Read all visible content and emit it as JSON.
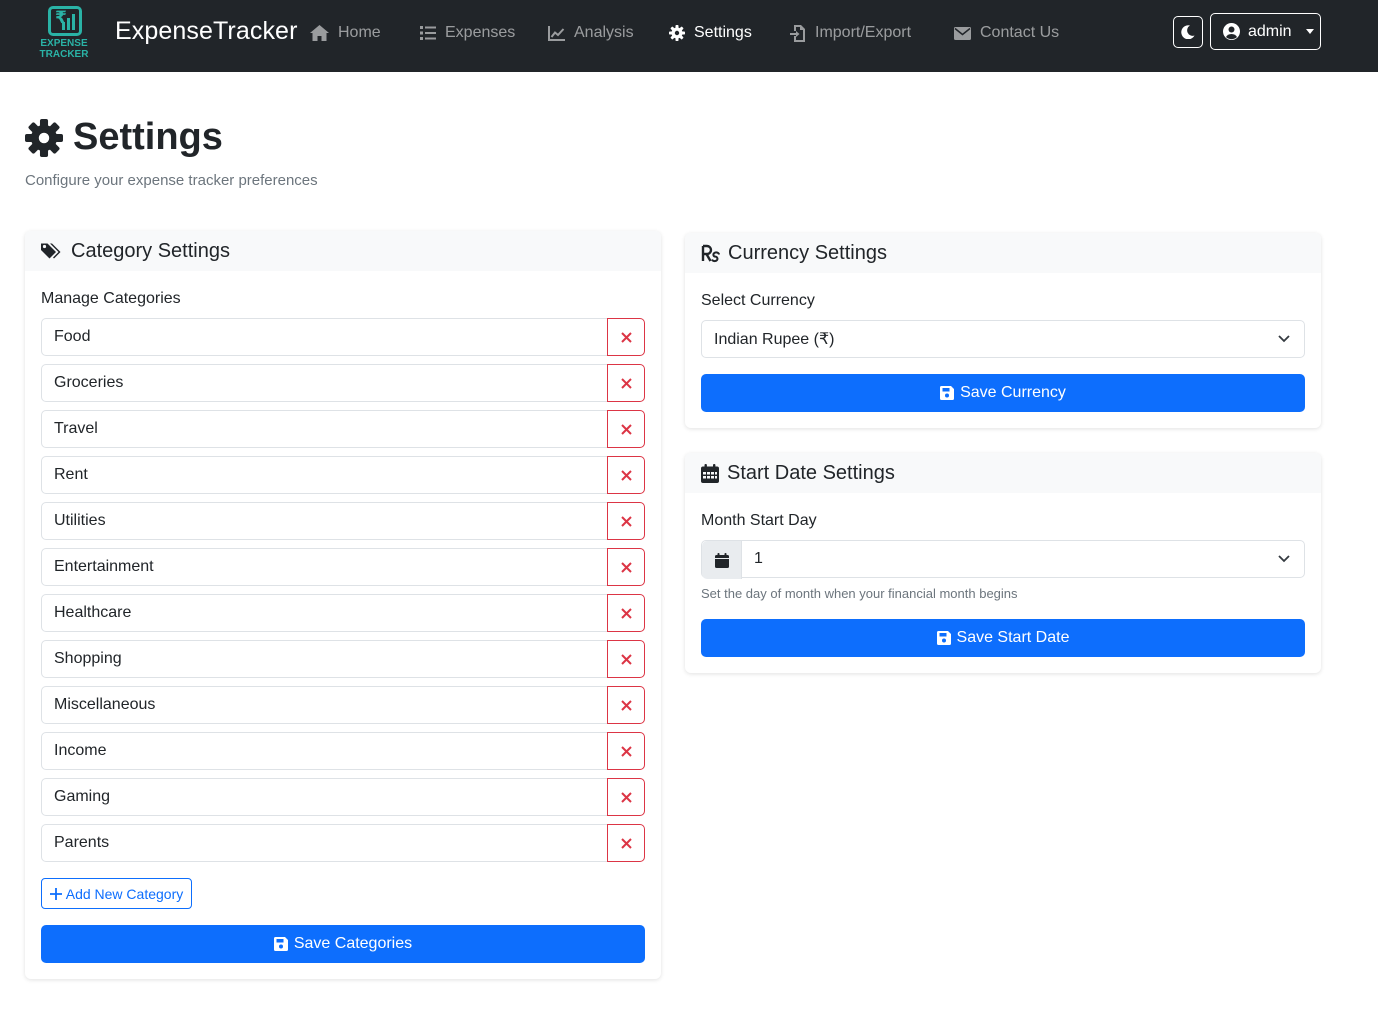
{
  "brand": {
    "logo_text": "EXPENSE TRACKER",
    "name": "ExpenseTracker",
    "accent": "#2ab3a6"
  },
  "nav": {
    "items": [
      {
        "label": "Home",
        "icon": "home-icon"
      },
      {
        "label": "Expenses",
        "icon": "list-icon"
      },
      {
        "label": "Analysis",
        "icon": "chart-line-icon"
      },
      {
        "label": "Settings",
        "icon": "gear-icon",
        "active": true
      },
      {
        "label": "Import/Export",
        "icon": "file-import-icon"
      },
      {
        "label": "Contact Us",
        "icon": "envelope-icon"
      }
    ],
    "user": "admin",
    "theme_icon": "moon-icon"
  },
  "page": {
    "title": "Settings",
    "subtitle": "Configure your expense tracker preferences"
  },
  "category_settings": {
    "title": "Category Settings",
    "label": "Manage Categories",
    "categories": [
      "Food",
      "Groceries",
      "Travel",
      "Rent",
      "Utilities",
      "Entertainment",
      "Healthcare",
      "Shopping",
      "Miscellaneous",
      "Income",
      "Gaming",
      "Parents"
    ],
    "add_label": "Add New Category",
    "save_label": "Save Categories"
  },
  "currency_settings": {
    "title": "Currency Settings",
    "label": "Select Currency",
    "selected": "Indian Rupee (₹)",
    "save_label": "Save Currency"
  },
  "start_date_settings": {
    "title": "Start Date Settings",
    "label": "Month Start Day",
    "selected": "1",
    "help": "Set the day of month when your financial month begins",
    "save_label": "Save Start Date"
  },
  "colors": {
    "navbar": "#212529",
    "primary": "#0d6efd",
    "danger": "#dc3545",
    "muted": "#6c757d"
  }
}
